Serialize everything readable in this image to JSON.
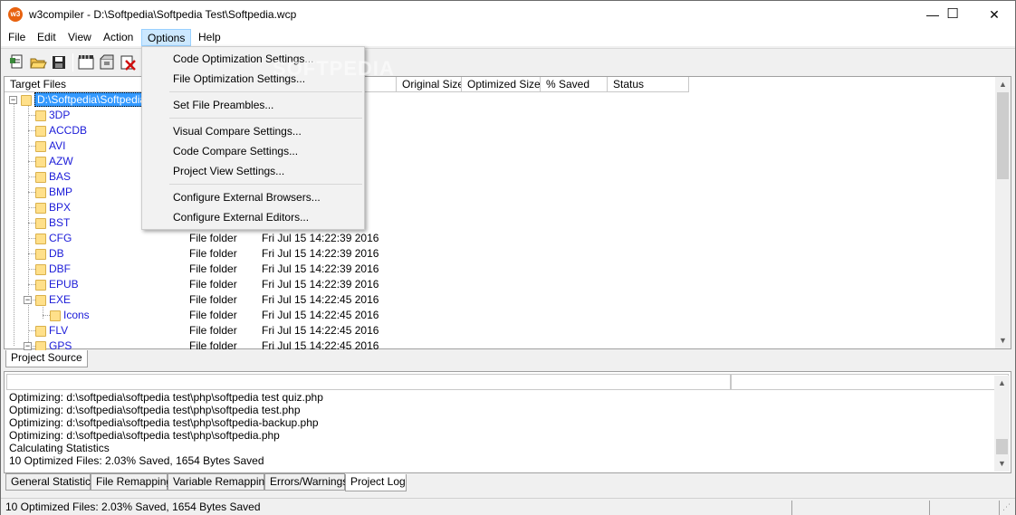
{
  "window": {
    "title": "w3compiler - D:\\Softpedia\\Softpedia Test\\Softpedia.wcp",
    "app_icon_text": "w3",
    "buttons": {
      "minimize": "—",
      "maximize": "☐",
      "close": "✕"
    }
  },
  "menubar": {
    "items": [
      "File",
      "Edit",
      "View",
      "Action",
      "Options",
      "Help"
    ]
  },
  "options_menu": {
    "items": [
      "Code Optimization Settings...",
      "File Optimization Settings...",
      "Set File Preambles...",
      "Visual Compare Settings...",
      "Code Compare Settings...",
      "Project View Settings...",
      "Configure External Browsers...",
      "Configure External Editors..."
    ]
  },
  "watermark": "SOFTPEDIA",
  "columns": [
    "Target Files",
    "Original Size",
    "Optimized Size",
    "% Saved",
    "Status"
  ],
  "tree": {
    "root": "D:\\Softpedia\\Softpedia",
    "rows": [
      {
        "name": "3DP",
        "type": "",
        "date": ""
      },
      {
        "name": "ACCDB",
        "type": "",
        "date": ""
      },
      {
        "name": "AVI",
        "type": "",
        "date": ""
      },
      {
        "name": "AZW",
        "type": "",
        "date": ""
      },
      {
        "name": "BAS",
        "type": "",
        "date": ""
      },
      {
        "name": "BMP",
        "type": "",
        "date": ""
      },
      {
        "name": "BPX",
        "type": "",
        "date": ""
      },
      {
        "name": "BST",
        "type": "",
        "date": ""
      },
      {
        "name": "CFG",
        "type": "File folder",
        "date": "Fri Jul 15 14:22:39 2016"
      },
      {
        "name": "DB",
        "type": "File folder",
        "date": "Fri Jul 15 14:22:39 2016"
      },
      {
        "name": "DBF",
        "type": "File folder",
        "date": "Fri Jul 15 14:22:39 2016"
      },
      {
        "name": "EPUB",
        "type": "File folder",
        "date": "Fri Jul 15 14:22:39 2016"
      },
      {
        "name": "EXE",
        "type": "File folder",
        "date": "Fri Jul 15 14:22:45 2016"
      },
      {
        "name": "Icons",
        "type": "File folder",
        "date": "Fri Jul 15 14:22:45 2016"
      },
      {
        "name": "FLV",
        "type": "File folder",
        "date": "Fri Jul 15 14:22:45 2016"
      },
      {
        "name": "GPS",
        "type": "File folder",
        "date": "Fri Jul 15 14:22:45 2016"
      }
    ]
  },
  "upper_tabs": [
    "Project Source"
  ],
  "log": {
    "lines": [
      "Optimizing: d:\\softpedia\\softpedia test\\php\\softpedia test quiz.php",
      "Optimizing: d:\\softpedia\\softpedia test\\php\\softpedia test.php",
      "Optimizing: d:\\softpedia\\softpedia test\\php\\softpedia-backup.php",
      "Optimizing: d:\\softpedia\\softpedia test\\php\\softpedia.php",
      "Calculating Statistics",
      "10 Optimized Files: 2.03% Saved, 1654 Bytes Saved"
    ]
  },
  "lower_tabs": [
    "General Statistics",
    "File Remapping",
    "Variable Remapping",
    "Errors/Warnings",
    "Project Log"
  ],
  "status": {
    "text": "10 Optimized Files: 2.03% Saved, 1654 Bytes Saved"
  },
  "colors": {
    "selection": "#3399ff",
    "tree_text": "#1b1bd8",
    "menu_active": "#cce8ff"
  }
}
